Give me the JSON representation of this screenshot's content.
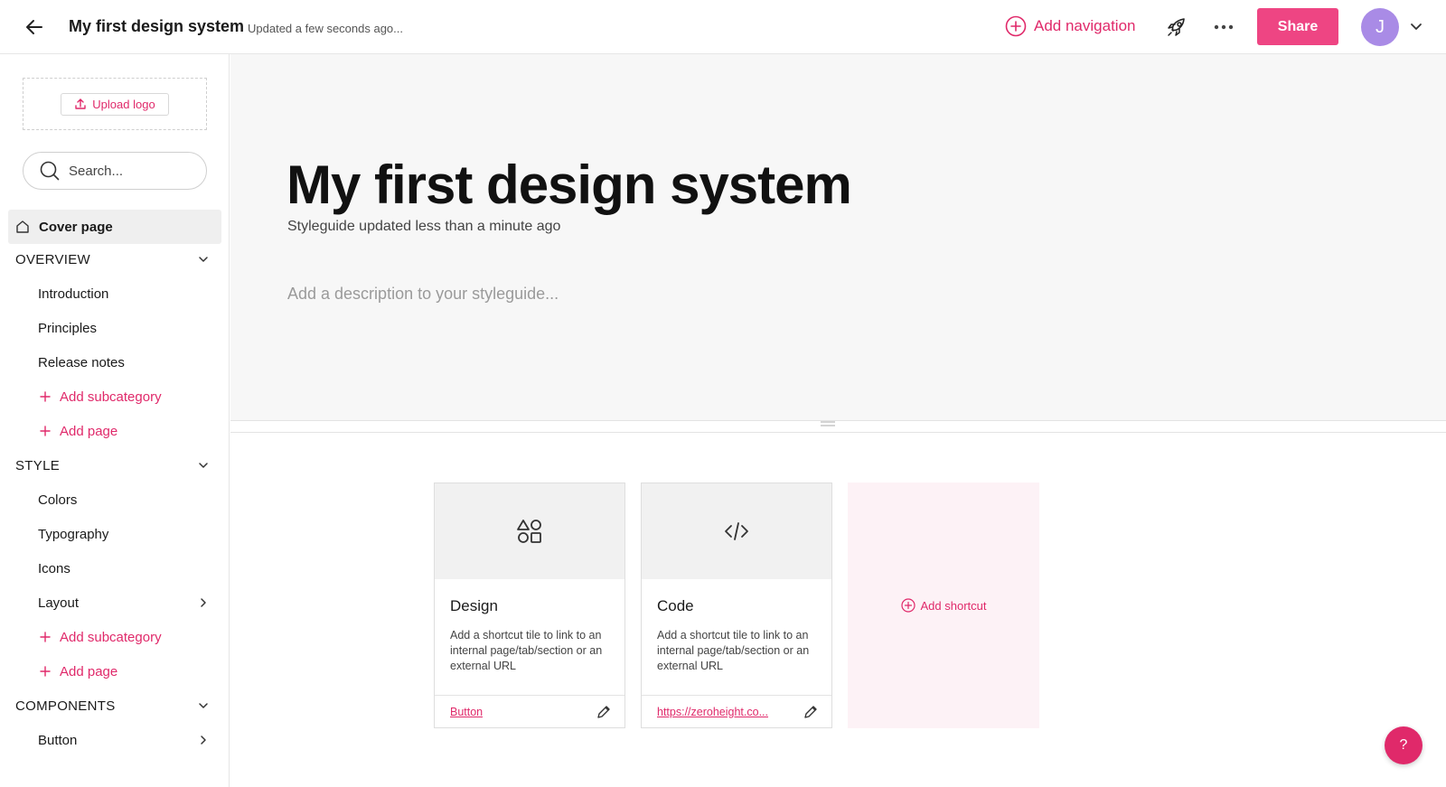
{
  "topbar": {
    "title": "My first design system",
    "updated": "Updated a few seconds ago...",
    "add_navigation": "Add navigation",
    "share": "Share",
    "avatar_initial": "J"
  },
  "sidebar": {
    "upload_logo": "Upload logo",
    "search_placeholder": "Search...",
    "cover_page": "Cover page",
    "sections": [
      {
        "label": "OVERVIEW",
        "pages": [
          "Introduction",
          "Principles",
          "Release notes"
        ],
        "add_subcategory": "Add subcategory",
        "add_page": "Add page"
      },
      {
        "label": "STYLE",
        "pages": [
          "Colors",
          "Typography",
          "Icons",
          "Layout"
        ],
        "add_subcategory": "Add subcategory",
        "add_page": "Add page"
      },
      {
        "label": "COMPONENTS",
        "pages": [
          "Button"
        ]
      }
    ]
  },
  "hero": {
    "title": "My first design system",
    "subtitle": "Styleguide updated less than a minute ago",
    "description_placeholder": "Add a description to your styleguide..."
  },
  "tiles": [
    {
      "title": "Design",
      "icon": "shapes-icon",
      "description": "Add a shortcut tile to link to an internal page/tab/section or an external URL",
      "link": "Button"
    },
    {
      "title": "Code",
      "icon": "code-icon",
      "description": "Add a shortcut tile to link to an internal page/tab/section or an external URL",
      "link": "https://zeroheight.co..."
    }
  ],
  "add_shortcut": "Add shortcut",
  "help": "?",
  "colors": {
    "accent": "#e0296a",
    "share_button": "#ee4583",
    "avatar": "#a98be6",
    "hero_bg": "#f7f7f7"
  }
}
